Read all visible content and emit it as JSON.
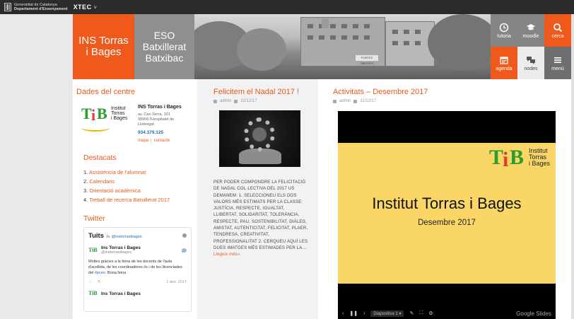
{
  "topbar": {
    "gov_line1": "Generalitat de Catalunya",
    "gov_line2": "Departament d'Ensenyament",
    "xtec": "XTEC",
    "chevron": "˅"
  },
  "header": {
    "nav_primary": "INS Torras i Bages",
    "nav_secondary": "ESO Batxillerat Batxibac",
    "banner_sign": "PORTES OBERTES",
    "tiles": [
      {
        "label": "tutoria",
        "icon": "clock-icon"
      },
      {
        "label": "moodle",
        "icon": "graduation-cap-icon"
      },
      {
        "label": "cerca",
        "icon": "search-icon"
      },
      {
        "label": "agenda",
        "icon": "calendar-icon"
      },
      {
        "label": "nodes",
        "icon": "chat-bubbles-icon"
      },
      {
        "label": "menú",
        "icon": "menu-icon"
      }
    ]
  },
  "centre": {
    "heading": "Dades del centre",
    "logo_words": [
      "Institut",
      "Torras",
      "i Bages"
    ],
    "name": "INS Torras i Bages",
    "address1": "av. Can Serra, 101",
    "address2": "08906 l'Hospitalet de",
    "address3": "Llobregat",
    "phone": "934.379.125",
    "link_map": "mapa",
    "link_sep": "|",
    "link_contact": "contacte"
  },
  "destacats": {
    "heading": "Destacats",
    "items": [
      {
        "num": "1.",
        "label": "Assistència de l'alumnat"
      },
      {
        "num": "2.",
        "label": "Calendaris"
      },
      {
        "num": "3.",
        "label": "Orientació acadèmica"
      },
      {
        "num": "4.",
        "label": "Treball de recerca Batxillerat 2017"
      }
    ]
  },
  "twitter": {
    "heading": "Twitter",
    "widget_title": "Tuits",
    "widget_by": "de",
    "widget_handle": "@instorrasibages",
    "tweet1": {
      "name": "Ins Torras i Bages",
      "handle": "@instorrasibages",
      "text_before": "Moltes gràcies a la feina de les docents de l'aula d'acollida, de les coordinadores i/s i de les llicenciades del",
      "tag": "#pceo",
      "text_after": ". Bona feina",
      "date": "1 des. 2017"
    },
    "tweet2": {
      "name": "Ins Torras i Bages"
    }
  },
  "post": {
    "title": "Felicitem el Nadal 2017 !",
    "author": "admin",
    "date": "12/12/17",
    "body": "PER PODER COMPONDRE LA FELICITACIÓ DE NADAL COL·LECTIVA DEL 2017 US DEMANEM: 1. SELECCIONEU ELS DOS VALORS MÉS ESTIMATS PER LA CLASSE: JUSTÍCIA, RESPECTE, IGUALTAT, LLIBERTAT, SOLIDARITAT, TOLERÀNCIA, RESPECTE, PAU, SOSTENIBILITAT, DIÀLEG, AMISTAT, AUTENTICITAT, FELICITAT, PLAER, TENDRESA, CREATIVITAT, PROFESSIONALITAT 2. CERQUEU AQUÍ LES DUES IMATGES MÉS ESTIMADES PER LA...",
    "more": "Llegeix més»"
  },
  "activitats": {
    "title": "Activitats – Desembre 2017",
    "author": "admin",
    "date": "11/12/17",
    "slide_logo_words": [
      "Institut",
      "Torras",
      "i Bages"
    ],
    "slide_title": "Institut Torras i Bages",
    "slide_subtitle": "Desembre 2017",
    "slide_num": "Diapositiva 1",
    "brand": "Google Slides"
  },
  "colors": {
    "accent": "#ef5a1c",
    "gray_nav": "#8f8f8f",
    "slide_bg": "#fad667",
    "logo_green": "#2a9d2a",
    "logo_red": "#e23b2b"
  }
}
